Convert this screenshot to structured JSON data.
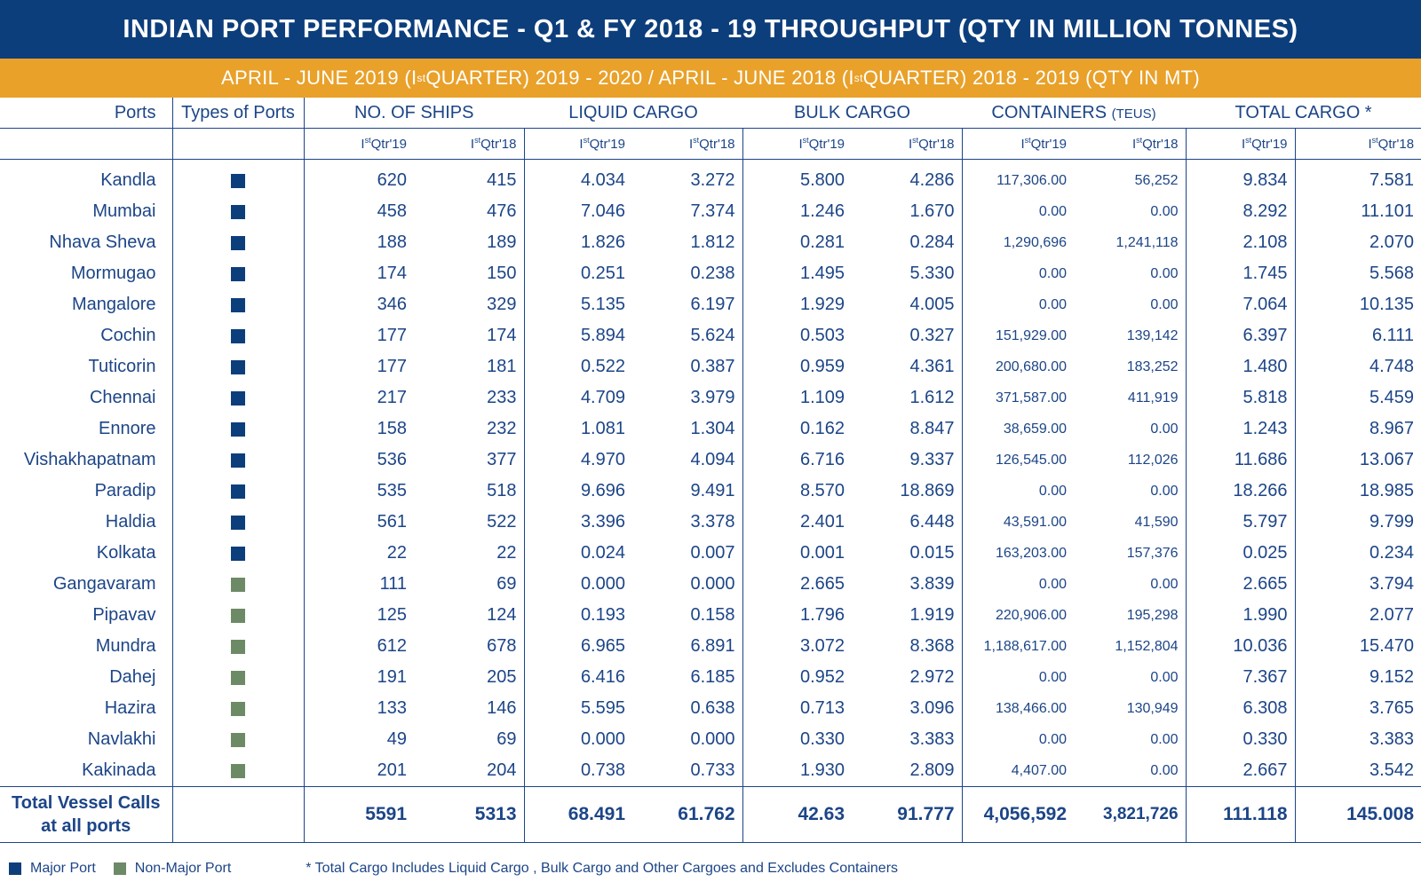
{
  "header": {
    "title": "INDIAN PORT PERFORMANCE - Q1 & FY 2018 - 19 THROUGHPUT (QTY IN MILLION TONNES)",
    "subtitle": {
      "part1": "APRIL - JUNE 2019 (I",
      "sup1": "st",
      "part2": " QUARTER) 2019 - 2020 / APRIL - JUNE 2018 (I",
      "sup2": "st",
      "part3": " QUARTER)  2018 - 2019 (QTY IN MT)"
    }
  },
  "columns": {
    "ports": "Ports",
    "types": "Types of Ports",
    "ships": "NO. OF SHIPS",
    "liquid": "LIQUID CARGO",
    "bulk": "BULK CARGO",
    "containers": "CONTAINERS",
    "containers_unit": "(TEUS)",
    "total": "TOTAL CARGO *"
  },
  "quarters": {
    "q19": "Qtr'19",
    "q18": "Qtr'18",
    "prefix": "I",
    "sup": "st"
  },
  "colors": {
    "major": "#0d3e7c",
    "non_major": "#6d8a66",
    "title_bg": "#0d3e7c",
    "subtitle_bg": "#e9a12a"
  },
  "rows": [
    {
      "port": "Kandla",
      "type": "major",
      "ships19": "620",
      "ships18": "415",
      "liq19": "4.034",
      "liq18": "3.272",
      "bulk19": "5.800",
      "bulk18": "4.286",
      "cont19": "117,306.00",
      "cont18": "56,252",
      "tot19": "9.834",
      "tot18": "7.581"
    },
    {
      "port": "Mumbai",
      "type": "major",
      "ships19": "458",
      "ships18": "476",
      "liq19": "7.046",
      "liq18": "7.374",
      "bulk19": "1.246",
      "bulk18": "1.670",
      "cont19": "0.00",
      "cont18": "0.00",
      "tot19": "8.292",
      "tot18": "11.101"
    },
    {
      "port": "Nhava Sheva",
      "type": "major",
      "ships19": "188",
      "ships18": "189",
      "liq19": "1.826",
      "liq18": "1.812",
      "bulk19": "0.281",
      "bulk18": "0.284",
      "cont19": "1,290,696",
      "cont18": "1,241,118",
      "tot19": "2.108",
      "tot18": "2.070"
    },
    {
      "port": "Mormugao",
      "type": "major",
      "ships19": "174",
      "ships18": "150",
      "liq19": "0.251",
      "liq18": "0.238",
      "bulk19": "1.495",
      "bulk18": "5.330",
      "cont19": "0.00",
      "cont18": "0.00",
      "tot19": "1.745",
      "tot18": "5.568"
    },
    {
      "port": "Mangalore",
      "type": "major",
      "ships19": "346",
      "ships18": "329",
      "liq19": "5.135",
      "liq18": "6.197",
      "bulk19": "1.929",
      "bulk18": "4.005",
      "cont19": "0.00",
      "cont18": "0.00",
      "tot19": "7.064",
      "tot18": "10.135"
    },
    {
      "port": "Cochin",
      "type": "major",
      "ships19": "177",
      "ships18": "174",
      "liq19": "5.894",
      "liq18": "5.624",
      "bulk19": "0.503",
      "bulk18": "0.327",
      "cont19": "151,929.00",
      "cont18": "139,142",
      "tot19": "6.397",
      "tot18": "6.111"
    },
    {
      "port": "Tuticorin",
      "type": "major",
      "ships19": "177",
      "ships18": "181",
      "liq19": "0.522",
      "liq18": "0.387",
      "bulk19": "0.959",
      "bulk18": "4.361",
      "cont19": "200,680.00",
      "cont18": "183,252",
      "tot19": "1.480",
      "tot18": "4.748"
    },
    {
      "port": "Chennai",
      "type": "major",
      "ships19": "217",
      "ships18": "233",
      "liq19": "4.709",
      "liq18": "3.979",
      "bulk19": "1.109",
      "bulk18": "1.612",
      "cont19": "371,587.00",
      "cont18": "411,919",
      "tot19": "5.818",
      "tot18": "5.459"
    },
    {
      "port": "Ennore",
      "type": "major",
      "ships19": "158",
      "ships18": "232",
      "liq19": "1.081",
      "liq18": "1.304",
      "bulk19": "0.162",
      "bulk18": "8.847",
      "cont19": "38,659.00",
      "cont18": "0.00",
      "tot19": "1.243",
      "tot18": "8.967"
    },
    {
      "port": "Vishakhapatnam",
      "type": "major",
      "ships19": "536",
      "ships18": "377",
      "liq19": "4.970",
      "liq18": "4.094",
      "bulk19": "6.716",
      "bulk18": "9.337",
      "cont19": "126,545.00",
      "cont18": "112,026",
      "tot19": "11.686",
      "tot18": "13.067"
    },
    {
      "port": "Paradip",
      "type": "major",
      "ships19": "535",
      "ships18": "518",
      "liq19": "9.696",
      "liq18": "9.491",
      "bulk19": "8.570",
      "bulk18": "18.869",
      "cont19": "0.00",
      "cont18": "0.00",
      "tot19": "18.266",
      "tot18": "18.985"
    },
    {
      "port": "Haldia",
      "type": "major",
      "ships19": "561",
      "ships18": "522",
      "liq19": "3.396",
      "liq18": "3.378",
      "bulk19": "2.401",
      "bulk18": "6.448",
      "cont19": "43,591.00",
      "cont18": "41,590",
      "tot19": "5.797",
      "tot18": "9.799"
    },
    {
      "port": "Kolkata",
      "type": "major",
      "ships19": "22",
      "ships18": "22",
      "liq19": "0.024",
      "liq18": "0.007",
      "bulk19": "0.001",
      "bulk18": "0.015",
      "cont19": "163,203.00",
      "cont18": "157,376",
      "tot19": "0.025",
      "tot18": "0.234"
    },
    {
      "port": "Gangavaram",
      "type": "non_major",
      "ships19": "111",
      "ships18": "69",
      "liq19": "0.000",
      "liq18": "0.000",
      "bulk19": "2.665",
      "bulk18": "3.839",
      "cont19": "0.00",
      "cont18": "0.00",
      "tot19": "2.665",
      "tot18": "3.794"
    },
    {
      "port": "Pipavav",
      "type": "non_major",
      "ships19": "125",
      "ships18": "124",
      "liq19": "0.193",
      "liq18": "0.158",
      "bulk19": "1.796",
      "bulk18": "1.919",
      "cont19": "220,906.00",
      "cont18": "195,298",
      "tot19": "1.990",
      "tot18": "2.077"
    },
    {
      "port": "Mundra",
      "type": "non_major",
      "ships19": "612",
      "ships18": "678",
      "liq19": "6.965",
      "liq18": "6.891",
      "bulk19": "3.072",
      "bulk18": "8.368",
      "cont19": "1,188,617.00",
      "cont18": "1,152,804",
      "tot19": "10.036",
      "tot18": "15.470"
    },
    {
      "port": "Dahej",
      "type": "non_major",
      "ships19": "191",
      "ships18": "205",
      "liq19": "6.416",
      "liq18": "6.185",
      "bulk19": "0.952",
      "bulk18": "2.972",
      "cont19": "0.00",
      "cont18": "0.00",
      "tot19": "7.367",
      "tot18": "9.152"
    },
    {
      "port": "Hazira",
      "type": "non_major",
      "ships19": "133",
      "ships18": "146",
      "liq19": "5.595",
      "liq18": "0.638",
      "bulk19": "0.713",
      "bulk18": "3.096",
      "cont19": "138,466.00",
      "cont18": "130,949",
      "tot19": "6.308",
      "tot18": "3.765"
    },
    {
      "port": "Navlakhi",
      "type": "non_major",
      "ships19": "49",
      "ships18": "69",
      "liq19": "0.000",
      "liq18": "0.000",
      "bulk19": "0.330",
      "bulk18": "3.383",
      "cont19": "0.00",
      "cont18": "0.00",
      "tot19": "0.330",
      "tot18": "3.383"
    },
    {
      "port": "Kakinada",
      "type": "non_major",
      "ships19": "201",
      "ships18": "204",
      "liq19": "0.738",
      "liq18": "0.733",
      "bulk19": "1.930",
      "bulk18": "2.809",
      "cont19": "4,407.00",
      "cont18": "0.00",
      "tot19": "2.667",
      "tot18": "3.542"
    }
  ],
  "total": {
    "label_line1": "Total Vessel Calls",
    "label_line2": "at all ports",
    "ships19": "5591",
    "ships18": "5313",
    "liq19": "68.491",
    "liq18": "61.762",
    "bulk19": "42.63",
    "bulk18": "91.777",
    "cont19": "4,056,592",
    "cont18": "3,821,726",
    "tot19": "111.118",
    "tot18": "145.008"
  },
  "legend": {
    "major": "Major Port",
    "non_major": "Non-Major Port"
  },
  "footnote": "* Total Cargo Includes Liquid Cargo , Bulk Cargo and Other Cargoes and Excludes Containers"
}
